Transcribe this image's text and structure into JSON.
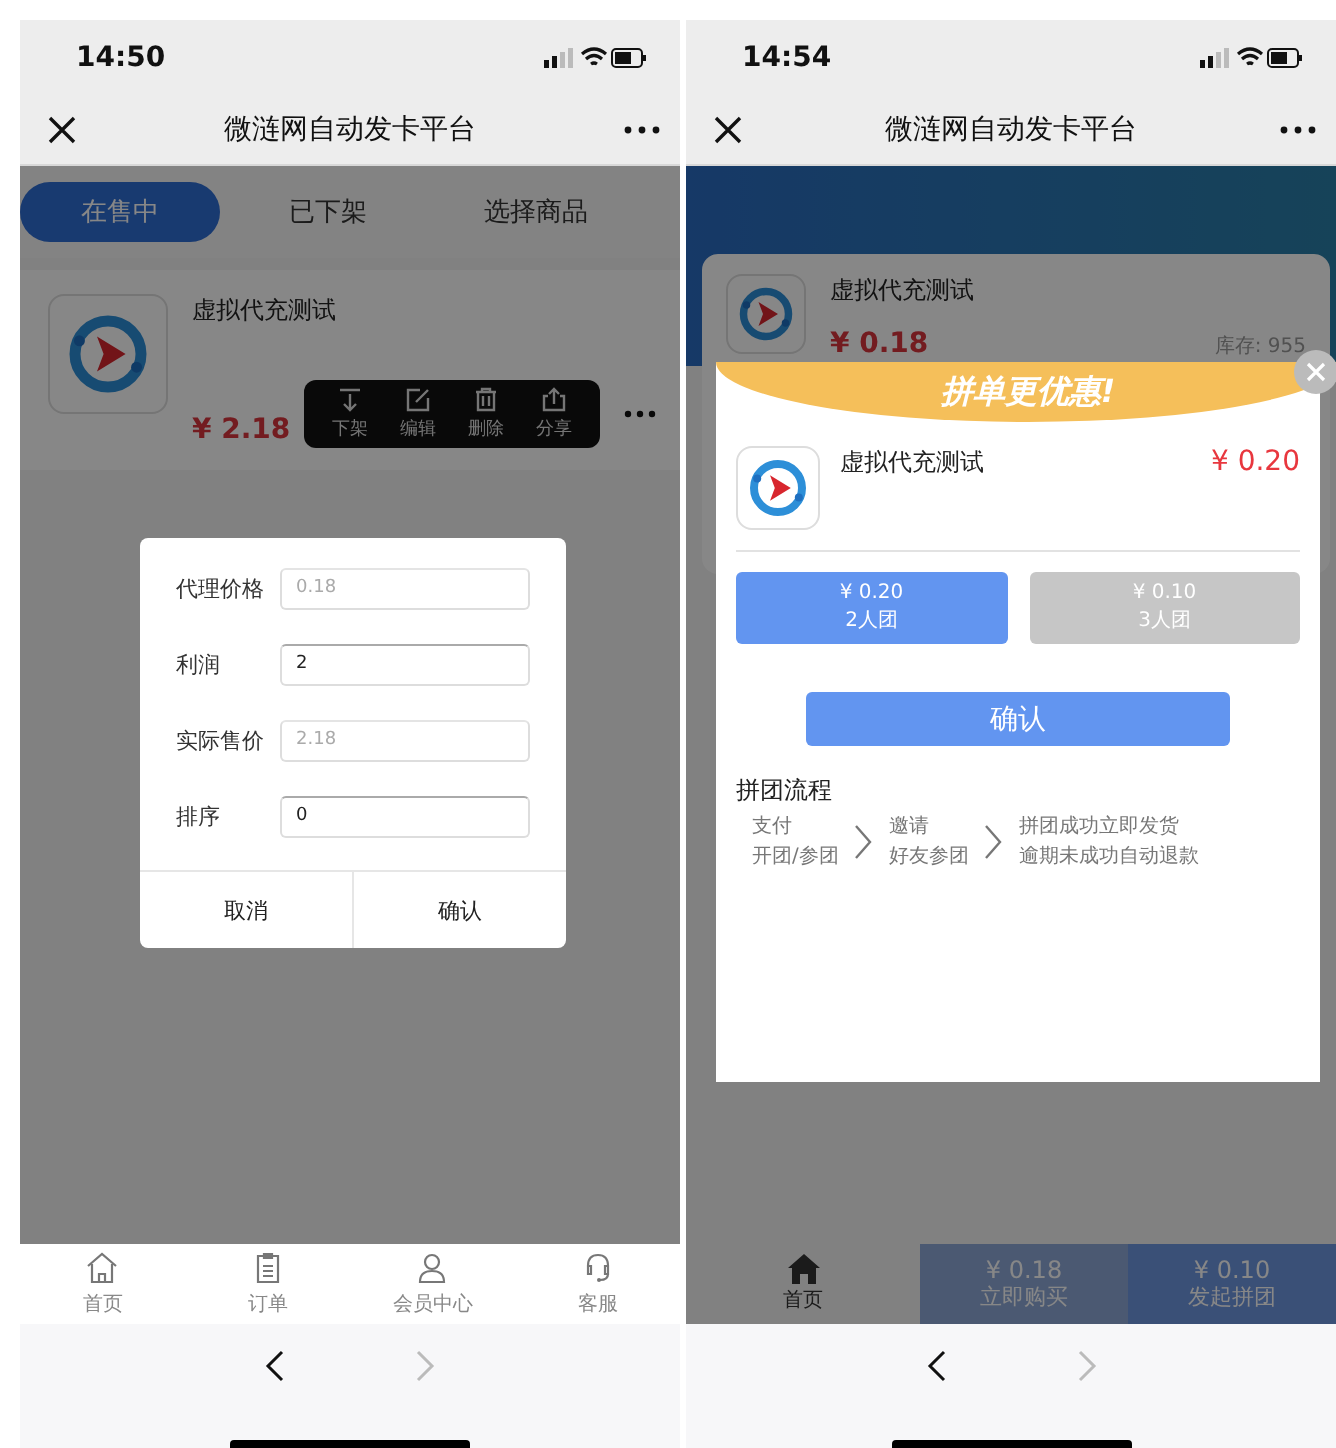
{
  "left_screen": {
    "status_bar": {
      "time": "14:50"
    },
    "nav_bar": {
      "title": "微涟网自动发卡平台"
    },
    "tabs": [
      {
        "label": "在售中",
        "selected": true
      },
      {
        "label": "已下架",
        "selected": false
      },
      {
        "label": "选择商品",
        "selected": false
      }
    ],
    "product": {
      "name": "虚拟代充测试",
      "price": "¥ 2.18"
    },
    "action_menu": [
      {
        "kind": "unlist",
        "label": "下架"
      },
      {
        "kind": "edit",
        "label": "编辑"
      },
      {
        "kind": "delete",
        "label": "删除"
      },
      {
        "kind": "share",
        "label": "分享"
      }
    ],
    "dialog": {
      "fields": [
        {
          "label": "代理价格",
          "value": "0.18",
          "disabled": true
        },
        {
          "label": "利润",
          "value": "2",
          "disabled": false
        },
        {
          "label": "实际售价",
          "value": "2.18",
          "disabled": true
        },
        {
          "label": "排序",
          "value": "0",
          "disabled": false
        }
      ],
      "buttons": [
        "取消",
        "确认"
      ]
    },
    "tab_bar": [
      {
        "kind": "home",
        "label": "首页"
      },
      {
        "kind": "orders",
        "label": "订单"
      },
      {
        "kind": "member",
        "label": "会员中心"
      },
      {
        "kind": "service",
        "label": "客服"
      }
    ],
    "browser_nav": {
      "back_disabled": false,
      "forward_disabled": true
    }
  },
  "right_screen": {
    "status_bar": {
      "time": "14:54"
    },
    "nav_bar": {
      "title": "微涟网自动发卡平台"
    },
    "product": {
      "name": "虚拟代充测试",
      "price": "¥ 0.18",
      "stock": "库存: 955"
    },
    "popup": {
      "banner": "拼单更优惠!",
      "name": "虚拟代充测试",
      "price": "¥ 0.20",
      "options": [
        {
          "price": "¥ 0.20",
          "label": "2人团",
          "selected": true
        },
        {
          "price": "¥ 0.10",
          "label": "3人团",
          "selected": false
        }
      ],
      "confirm": "确认",
      "flow_title": "拼团流程",
      "steps": [
        {
          "title": "支付",
          "detail": "开团/参团"
        },
        {
          "title": "邀请",
          "detail": "好友参团"
        },
        {
          "title": "拼团成功立即发货",
          "detail": "逾期未成功自动退款"
        }
      ]
    },
    "bottom_bar": {
      "home": "首页",
      "buy": {
        "price": "¥ 0.18",
        "label": "立即购买"
      },
      "group": {
        "price": "¥ 0.10",
        "label": "发起拼团"
      }
    },
    "browser_nav": {
      "back_disabled": false,
      "forward_disabled": true
    }
  }
}
